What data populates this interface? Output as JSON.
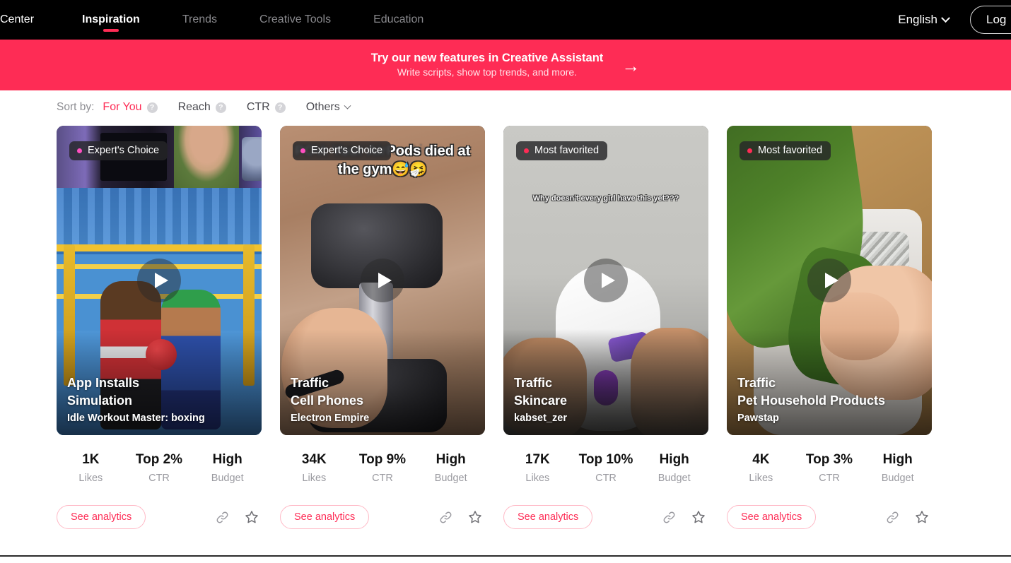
{
  "colors": {
    "accent": "#FE2C55",
    "nav_bg": "#000000",
    "badge_expert_dot": "#FF4FC0",
    "badge_favorite_dot": "#FE2C55"
  },
  "nav": {
    "brand": "Center",
    "links": [
      {
        "label": "Inspiration",
        "active": true
      },
      {
        "label": "Trends",
        "active": false
      },
      {
        "label": "Creative Tools",
        "active": false
      },
      {
        "label": "Education",
        "active": false
      }
    ],
    "language": "English",
    "login_label": "Log"
  },
  "promo": {
    "title": "Try our new features in Creative Assistant",
    "subtitle": "Write scripts, show top trends, and more.",
    "arrow": "→"
  },
  "sort": {
    "label": "Sort by:",
    "options": [
      {
        "label": "For You",
        "active": true,
        "has_help": true
      },
      {
        "label": "Reach",
        "active": false,
        "has_help": true
      },
      {
        "label": "CTR",
        "active": false,
        "has_help": true
      }
    ],
    "others_label": "Others",
    "help_glyph": "?"
  },
  "card_common": {
    "analytics_label": "See analytics",
    "link_icon": "link-icon",
    "favorite_icon": "star-icon",
    "play_icon": "play-icon",
    "stat_labels": {
      "likes": "Likes",
      "ctr": "CTR",
      "budget": "Budget"
    }
  },
  "cards": [
    {
      "badge": {
        "text": "Expert's Choice",
        "type": "expert"
      },
      "caption": "",
      "objective": "App Installs",
      "category": "Simulation",
      "brand": "Idle Workout Master: boxing",
      "likes": "1K",
      "ctr": "Top 2%",
      "budget": "High"
    },
    {
      "badge": {
        "text": "Expert's Choice",
        "type": "expert"
      },
      "caption": "POV: Your AirPods died at the gym😅🤧",
      "objective": "Traffic",
      "category": "Cell Phones",
      "brand": "Electron Empire",
      "likes": "34K",
      "ctr": "Top 9%",
      "budget": "High"
    },
    {
      "badge": {
        "text": "Most favorited",
        "type": "favorite"
      },
      "caption": "Why doesn't every girl have this yet???",
      "objective": "Traffic",
      "category": "Skincare",
      "brand": "kabset_zer",
      "likes": "17K",
      "ctr": "Top 10%",
      "budget": "High"
    },
    {
      "badge": {
        "text": "Most favorited",
        "type": "favorite"
      },
      "caption": "",
      "objective": "Traffic",
      "category": "Pet Household Products",
      "brand": "Pawstap",
      "likes": "4K",
      "ctr": "Top 3%",
      "budget": "High"
    }
  ]
}
